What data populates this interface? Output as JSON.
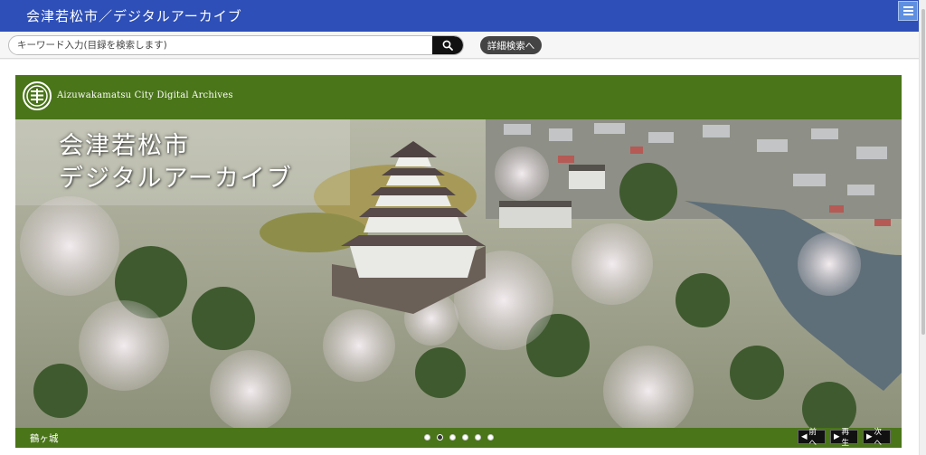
{
  "header": {
    "site_title": "会津若松市／デジタルアーカイブ",
    "menu_icon": "hamburger-menu-icon",
    "bg_color": "#2e4fb7"
  },
  "search": {
    "placeholder": "キーワード入力(目録を検索します)",
    "value": "",
    "button_icon": "search-icon",
    "advanced_label": "詳細検索へ"
  },
  "banner": {
    "logo_icon": "city-emblem-icon",
    "subtitle": "Aizuwakamatsu City Digital Archives",
    "bg_color": "#4a7519"
  },
  "hero": {
    "title_line1": "会津若松市",
    "title_line2": "デジタルアーカイブ",
    "image_subject": "aerial-castle-cherry-blossoms"
  },
  "slideshow": {
    "caption": "鶴ヶ城",
    "slide_count": 6,
    "active_slide": 2,
    "prev_label": "前へ",
    "play_label": "再生",
    "next_label": "次へ"
  }
}
